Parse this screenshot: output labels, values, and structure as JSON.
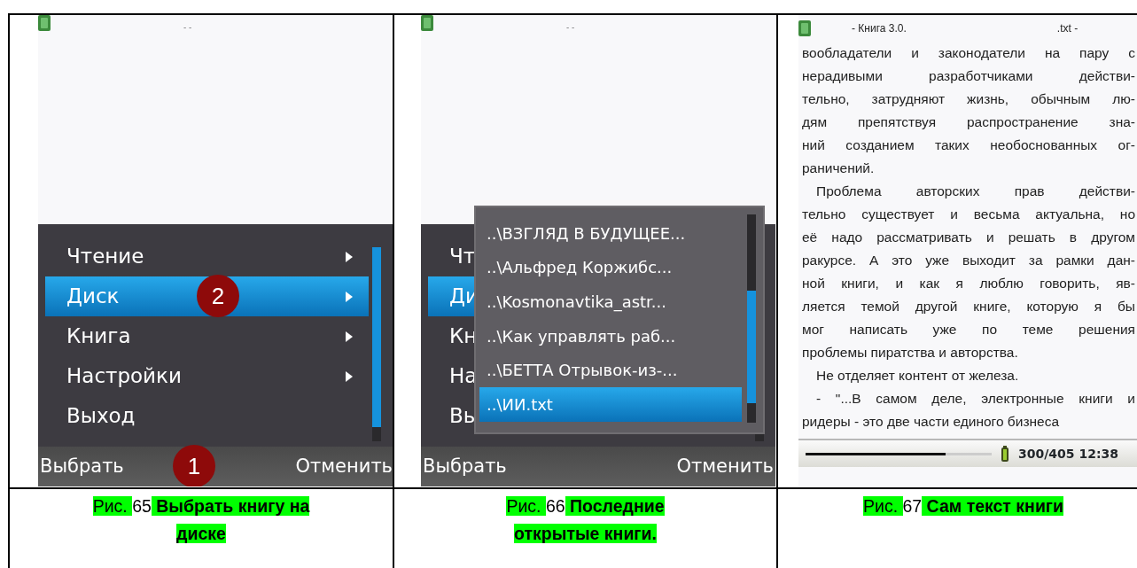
{
  "figures": [
    {
      "kind": "main_menu",
      "status_title": "- -",
      "menu": [
        {
          "label": "Чтение",
          "submenu": true,
          "selected": false
        },
        {
          "label": "Диск",
          "submenu": true,
          "selected": true,
          "marker": "2"
        },
        {
          "label": "Книга",
          "submenu": true,
          "selected": false
        },
        {
          "label": "Настройки",
          "submenu": true,
          "selected": false
        },
        {
          "label": "Выход",
          "submenu": false,
          "selected": false
        }
      ],
      "softkeys": {
        "left": "Выбрать",
        "right": "Отменить",
        "marker": "1"
      },
      "caption": {
        "label": "Рис.",
        "number": "65",
        "title": "Выбрать книгу на диске"
      }
    },
    {
      "kind": "recent_books",
      "status_title": "- -",
      "menu": [
        {
          "label": "Чт",
          "selected": false
        },
        {
          "label": "Ди",
          "selected": true
        },
        {
          "label": "Кн",
          "selected": false
        },
        {
          "label": "На",
          "selected": false
        },
        {
          "label": "Вы",
          "selected": false
        }
      ],
      "popup": [
        {
          "label": "..\\ВЗГЛЯД В БУДУЩЕЕ...",
          "selected": false
        },
        {
          "label": "..\\Альфред Коржибс...",
          "selected": false
        },
        {
          "label": "..\\Kosmonavtika_astr...",
          "selected": false
        },
        {
          "label": "..\\Как управлять раб...",
          "selected": false
        },
        {
          "label": "..\\БЕТТА Отрывок-из-...",
          "selected": false
        },
        {
          "label": "..\\ИИ.txt",
          "selected": true
        }
      ],
      "softkeys": {
        "left": "Выбрать",
        "right": "Отменить"
      },
      "caption": {
        "label": "Рис.",
        "number": "66",
        "title": "Последние открытые книги."
      }
    },
    {
      "kind": "reader",
      "title_left": "- Книга 3.0.",
      "title_right": ".txt -",
      "paragraphs": [
        {
          "indented": false,
          "lines": [
            "вообладатели и законодатели на пару с",
            "нерадивыми разработчиками действи-",
            "тельно, затрудняют жизнь, обычным лю-",
            "дям препятствуя распространение зна-",
            "ний созданием таких необоснованных ог-",
            "раничений."
          ]
        },
        {
          "indented": true,
          "lines": [
            "Проблема авторских прав действи-",
            "тельно существует и весьма актуальна, но",
            "её надо рассматривать и решать в другом",
            "ракурсе. А это уже выходит за рамки дан-",
            "ной книги, и как я люблю говорить, яв-",
            "ляется темой другой книге, которую я бы",
            "мог написать уже по теме решения",
            "проблемы пиратства и авторства."
          ]
        },
        {
          "indented": true,
          "lines": [
            "Не отделяет контент от железа."
          ]
        },
        {
          "indented": true,
          "lines": [
            "- \"...В самом деле, электронные книги и",
            "ридеры - это две части единого бизнеса"
          ]
        }
      ],
      "progress": {
        "level": 0.75
      },
      "status": "300/405 12:38",
      "caption": {
        "label": "Рис.",
        "number": "67",
        "title": "Сам текст книги"
      }
    }
  ]
}
